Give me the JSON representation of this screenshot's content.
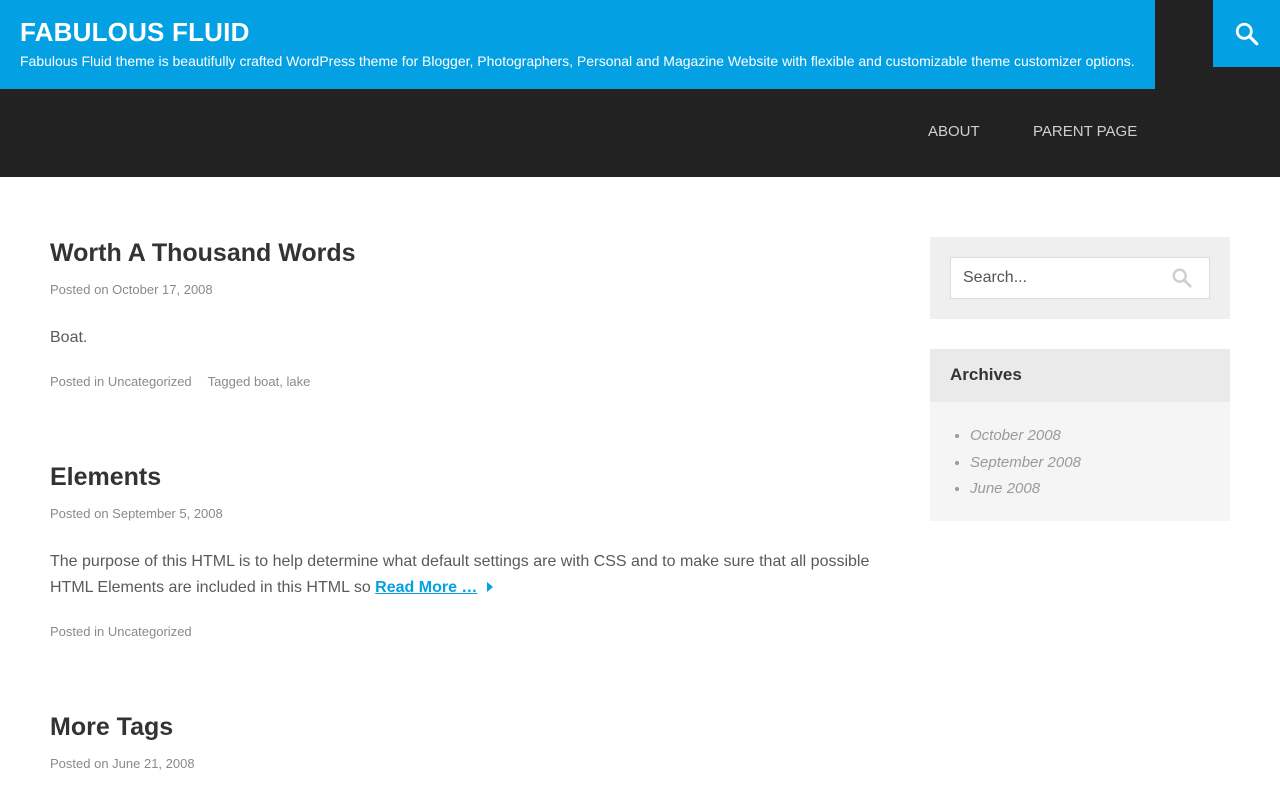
{
  "site": {
    "title": "FABULOUS FLUID",
    "description": "Fabulous Fluid theme is beautifully crafted WordPress theme for Blogger, Photographers, Personal and Magazine Website with flexible and customizable theme customizer options."
  },
  "nav": {
    "items": [
      "ABOUT",
      "PARENT PAGE"
    ]
  },
  "posts": [
    {
      "title": "Worth A Thousand Words",
      "posted_on_label": "Posted on",
      "date": "October 17, 2008",
      "content": "Boat.",
      "posted_in_label": "Posted in",
      "category": "Uncategorized",
      "tagged_label": "Tagged",
      "tags": [
        "boat",
        "lake"
      ]
    },
    {
      "title": "Elements",
      "posted_on_label": "Posted on",
      "date": "September 5, 2008",
      "content": "The purpose of this HTML is to help determine what default settings are with CSS and to make sure that all possible HTML Elements are included in this HTML so",
      "read_more": "Read More …",
      "posted_in_label": "Posted in",
      "category": "Uncategorized"
    },
    {
      "title": "More Tags",
      "posted_on_label": "Posted on",
      "date": "June 21, 2008"
    }
  ],
  "sidebar": {
    "search": {
      "placeholder": "Search..."
    },
    "archives": {
      "title": "Archives",
      "items": [
        "October 2008",
        "September 2008",
        "June 2008"
      ]
    }
  },
  "colors": {
    "accent": "#03a1e3",
    "header_bg": "#222222"
  },
  "icons": {
    "header_search": "search-icon",
    "sidebar_search": "search-icon",
    "read_more": "caret-right-icon"
  }
}
